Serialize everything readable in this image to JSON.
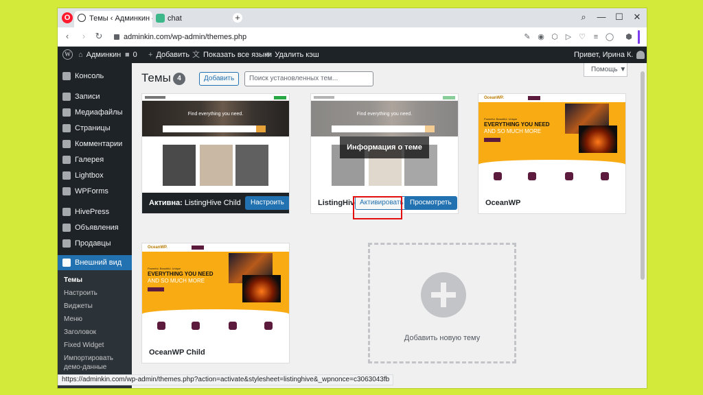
{
  "browser": {
    "tabs": [
      {
        "label": "Темы ‹ Админкин — Wor"
      },
      {
        "label": "chat"
      }
    ],
    "url": "adminkin.com/wp-admin/themes.php",
    "status_url": "https://adminkin.com/wp-admin/themes.php?action=activate&stylesheet=listinghive&_wpnonce=c3063043fb"
  },
  "adminbar": {
    "site_name": "Админкин",
    "comments_count": "0",
    "add_new": "Добавить",
    "show_languages": "Показать все языки",
    "clear_cache": "Удалить кэш",
    "greeting": "Привет, Ирина К."
  },
  "menu": {
    "items": [
      {
        "label": "Консоль"
      },
      {
        "label": "Записи"
      },
      {
        "label": "Медиафайлы"
      },
      {
        "label": "Страницы"
      },
      {
        "label": "Комментарии"
      },
      {
        "label": "Галерея"
      },
      {
        "label": "Lightbox"
      },
      {
        "label": "WPForms"
      },
      {
        "label": "HivePress"
      },
      {
        "label": "Объявления"
      },
      {
        "label": "Продавцы"
      },
      {
        "label": "Внешний вид"
      }
    ],
    "submenu": [
      {
        "label": "Темы"
      },
      {
        "label": "Настроить"
      },
      {
        "label": "Виджеты"
      },
      {
        "label": "Меню"
      },
      {
        "label": "Заголовок"
      },
      {
        "label": "Fixed Widget"
      },
      {
        "label": "Импортировать демо-данные"
      }
    ]
  },
  "page": {
    "title": "Темы",
    "count": "4",
    "add_button": "Добавить",
    "search_placeholder": "Поиск установленных тем...",
    "help": "Помощь ▼"
  },
  "themes": [
    {
      "active_label": "Активна:",
      "name": "ListingHive Child",
      "action": "Настроить",
      "hero_text": "Find everything you need."
    },
    {
      "name": "ListingHive",
      "overlay": "Информация о теме",
      "activate": "Активировать",
      "preview": "Просмотреть",
      "hero_text": "Find everything you need."
    },
    {
      "name": "OceanWP",
      "logo": "OceanWP.",
      "small": "Powerful. Beautiful. Unique",
      "headline": "EVERYTHING YOU NEED",
      "subline": "AND SO MUCH MORE"
    },
    {
      "name": "OceanWP Child",
      "logo": "OceanWP.",
      "small": "Powerful. Beautiful. Unique",
      "headline": "EVERYTHING YOU NEED",
      "subline": "AND SO MUCH MORE"
    }
  ],
  "add_new_theme": "Добавить новую тему",
  "colors": {
    "admin_dark": "#1d2327",
    "wp_blue": "#2271b1",
    "ocean_yellow": "#f9ab14",
    "highlight_red": "#e30d0d"
  }
}
